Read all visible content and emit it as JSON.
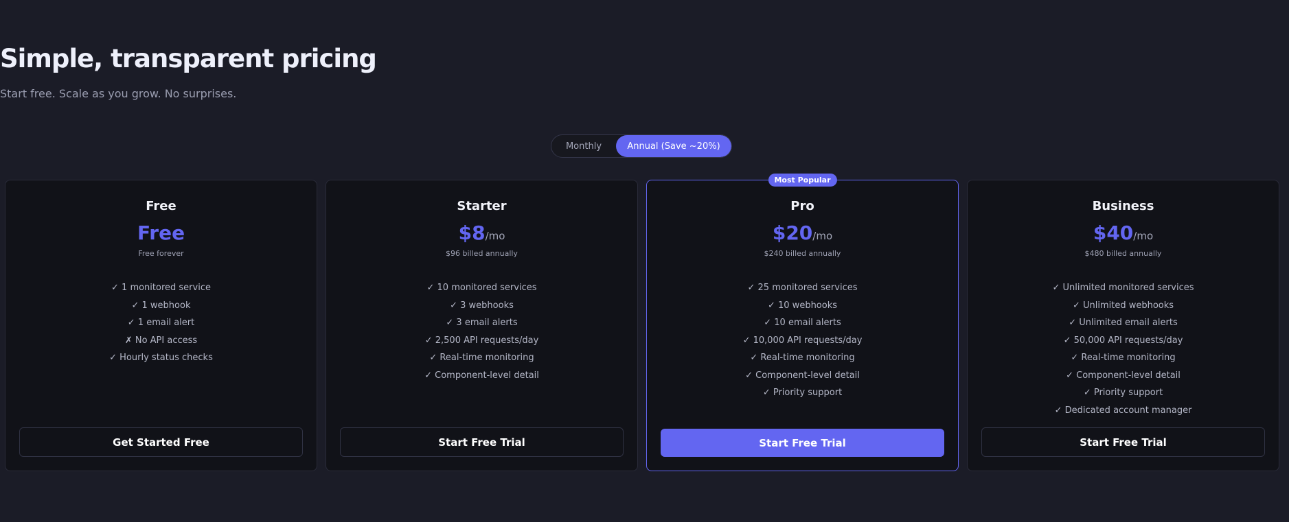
{
  "header": {
    "title": "Simple, transparent pricing",
    "subtitle": "Start free. Scale as you grow. No surprises."
  },
  "billing_toggle": {
    "monthly_label": "Monthly",
    "annual_label": "Annual (Save ~20%)",
    "selected": "annual"
  },
  "colors": {
    "accent": "#6366f1",
    "background": "#1b1c27",
    "card": "#111218"
  },
  "plans": [
    {
      "name": "Free",
      "price": "Free",
      "per": "",
      "billing": "Free forever",
      "features": [
        "✓ 1 monitored service",
        "✓ 1 webhook",
        "✓ 1 email alert",
        "✗ No API access",
        "✓ Hourly status checks"
      ],
      "cta": "Get Started Free"
    },
    {
      "name": "Starter",
      "price": "$8",
      "per": "/mo",
      "billing": "$96 billed annually",
      "features": [
        "✓ 10 monitored services",
        "✓ 3 webhooks",
        "✓ 3 email alerts",
        "✓ 2,500 API requests/day",
        "✓ Real-time monitoring",
        "✓ Component-level detail"
      ],
      "cta": "Start Free Trial"
    },
    {
      "name": "Pro",
      "badge": "Most Popular",
      "price": "$20",
      "per": "/mo",
      "billing": "$240 billed annually",
      "features": [
        "✓ 25 monitored services",
        "✓ 10 webhooks",
        "✓ 10 email alerts",
        "✓ 10,000 API requests/day",
        "✓ Real-time monitoring",
        "✓ Component-level detail",
        "✓ Priority support"
      ],
      "cta": "Start Free Trial"
    },
    {
      "name": "Business",
      "price": "$40",
      "per": "/mo",
      "billing": "$480 billed annually",
      "features": [
        "✓ Unlimited monitored services",
        "✓ Unlimited webhooks",
        "✓ Unlimited email alerts",
        "✓ 50,000 API requests/day",
        "✓ Real-time monitoring",
        "✓ Component-level detail",
        "✓ Priority support",
        "✓ Dedicated account manager"
      ],
      "cta": "Start Free Trial"
    }
  ]
}
